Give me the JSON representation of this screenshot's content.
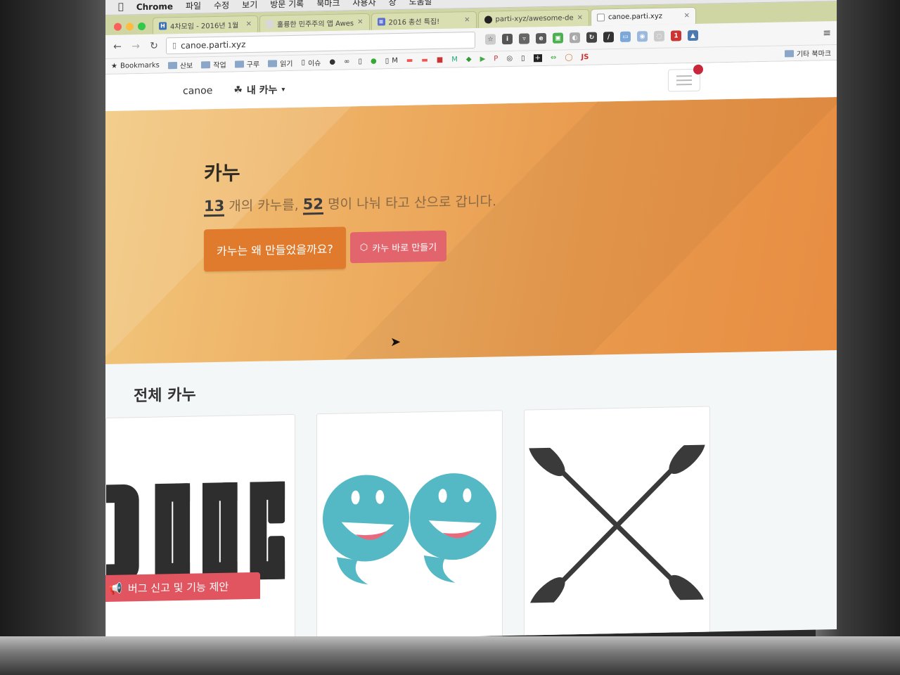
{
  "mac_menubar": {
    "app_name": "Chrome",
    "items": [
      "파일",
      "수정",
      "보기",
      "방문 기록",
      "북마크",
      "사용자",
      "창",
      "도움말"
    ]
  },
  "tabs": [
    {
      "label": "4차모임 - 2016년 1월",
      "favicon": "H",
      "color": "#3b6fb6"
    },
    {
      "label": "훌륭한 민주주의 앱 Awes",
      "favicon": "",
      "color": "#d8d8d8"
    },
    {
      "label": "2016 총선 특집!",
      "favicon": "≡",
      "color": "#5b6fd1"
    },
    {
      "label": "parti-xyz/awesome-de",
      "favicon": "●",
      "color": "#222"
    },
    {
      "label": "canoe.parti.xyz",
      "favicon": "",
      "color": "#ffffff",
      "active": true
    }
  ],
  "toolbar": {
    "url": "canoe.parti.xyz",
    "back_icon": "back-arrow-icon",
    "forward_icon": "forward-arrow-icon",
    "reload_icon": "reload-icon"
  },
  "bookmarks": {
    "label": "Bookmarks",
    "folders": [
      "산보",
      "작업",
      "구루",
      "읽기"
    ],
    "page_items": [
      "이슈",
      "M"
    ],
    "other": "기타 북마크"
  },
  "navbar": {
    "brand": "canoe",
    "my_canoe": "내 카누"
  },
  "hero": {
    "title": "카누",
    "canoe_count": "13",
    "canoe_count_suffix": " 개의 카누를, ",
    "member_count": "52",
    "member_count_suffix": " 명이 나눠 타고 산으로 갑니다.",
    "why_button": "카누는 왜 만들었을까요?",
    "create_button": "카누 바로 만들기"
  },
  "section": {
    "title": "전체 카누"
  },
  "feedback": {
    "label": "버그 신고 및 기능 제안"
  },
  "colors": {
    "hero_start": "#f1c77d",
    "hero_end": "#e78d42",
    "why_button": "#e07b2e",
    "create_button": "#e2646c",
    "feedback": "#e0555f",
    "card_teal": "#55b9c5",
    "card_pink": "#e86a7c"
  }
}
